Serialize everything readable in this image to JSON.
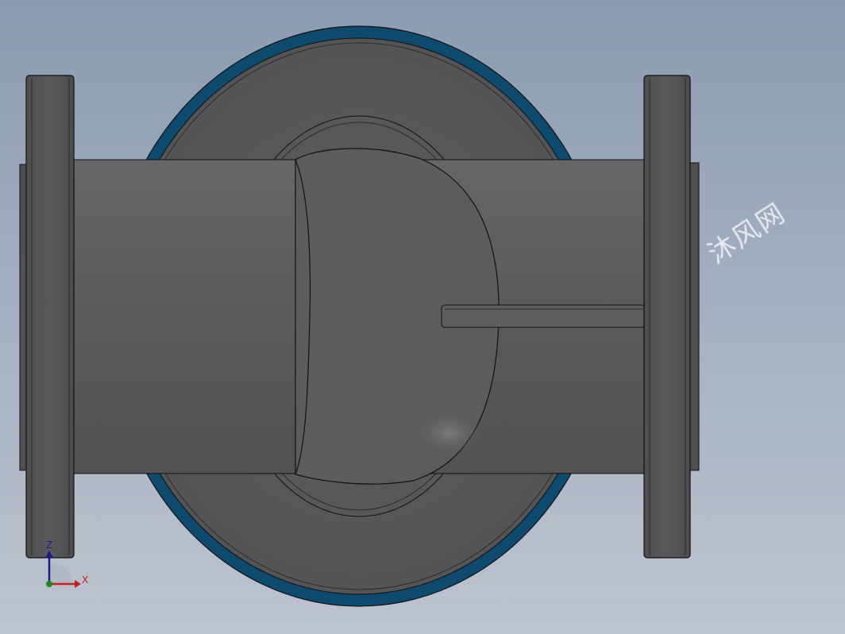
{
  "viewport": {
    "background_top": "#8b9bb1",
    "background_bottom": "#bdc3cf"
  },
  "model": {
    "body_color": "#5a5a5c",
    "body_dark_color": "#4a4a4c",
    "rim_color": "#0e4a6e",
    "edge_color": "#111111"
  },
  "triad": {
    "z_label": "Z",
    "x_label": "X",
    "z_color": "#1a1a8c",
    "x_color": "#c41e1e",
    "origin_color": "#1e8a1e"
  },
  "watermark": {
    "text": "沐风网"
  }
}
